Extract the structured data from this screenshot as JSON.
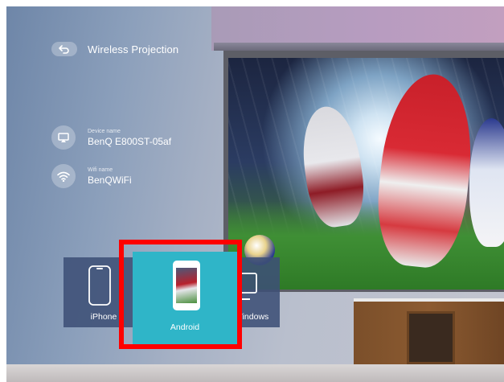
{
  "header": {
    "back_icon": "back-arrow-icon",
    "title": "Wireless Projection"
  },
  "device": {
    "icon": "cast-screen-icon",
    "label": "Device name",
    "value": "BenQ E800ST-05af"
  },
  "wifi": {
    "icon": "wifi-icon",
    "label": "Wifi name",
    "value": "BenQWiFi"
  },
  "tiles": [
    {
      "label": "iPhone",
      "icon": "iphone-icon"
    },
    {
      "label": "Android",
      "icon": "android-phone-icon"
    },
    {
      "label": "Windows",
      "icon": "windows-monitor-icon"
    }
  ],
  "selected_tile": "Android",
  "colors": {
    "selected_tile": "#2fb5c8",
    "tile_bg": "#3e5076",
    "highlight_border": "#ff0000"
  }
}
